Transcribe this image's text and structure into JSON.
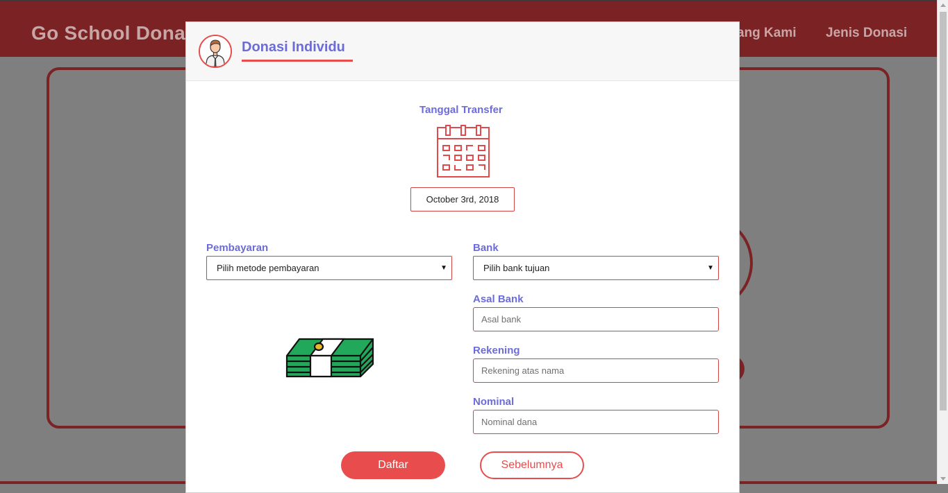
{
  "background": {
    "brand": "Go School Donat",
    "nav": [
      "ang Kami",
      "Jenis Donasi"
    ]
  },
  "modal": {
    "title": "Donasi Individu",
    "avatar_icon": "user-tie-icon",
    "transfer_date": {
      "label": "Tanggal Transfer",
      "icon": "calendar-icon",
      "value": "October 3rd, 2018"
    },
    "payment": {
      "label": "Pembayaran",
      "selected": "Pilih metode pembayaran",
      "icon": "money-stack-icon"
    },
    "bank": {
      "label": "Bank",
      "selected": "Pilih bank tujuan"
    },
    "origin_bank": {
      "label": "Asal Bank",
      "placeholder": "Asal bank"
    },
    "account": {
      "label": "Rekening",
      "placeholder": "Rekening atas nama"
    },
    "amount": {
      "label": "Nominal",
      "placeholder": "Nominal dana"
    },
    "buttons": {
      "submit": "Daftar",
      "previous": "Sebelumnya"
    }
  },
  "colors": {
    "accent": "#e84c4c",
    "label": "#6c6cd9",
    "navbar": "#7b2324"
  }
}
